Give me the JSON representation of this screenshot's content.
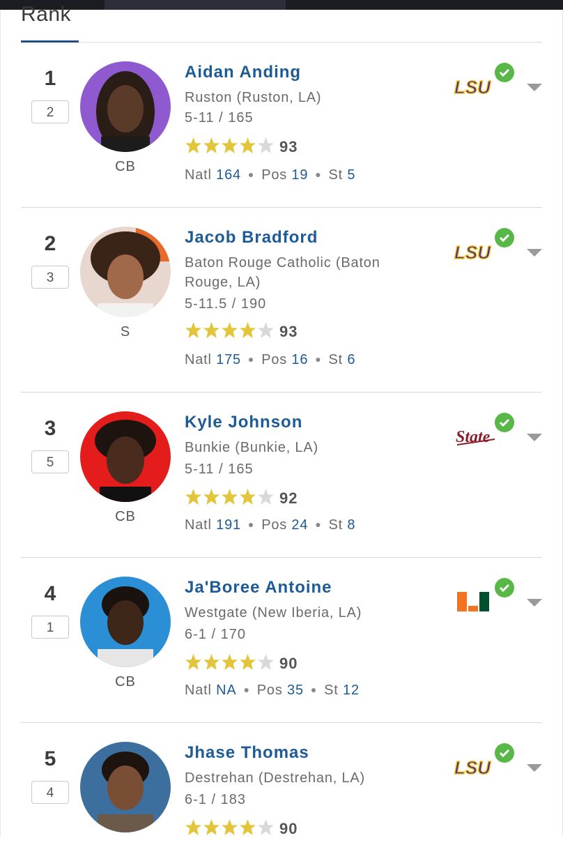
{
  "header": {
    "title": "Rank"
  },
  "colors": {
    "accent": "#1d5b96",
    "star": "#e2c53a",
    "star_empty": "#d9d9d9",
    "check": "#58b847"
  },
  "players": [
    {
      "rank": "1",
      "prev_rank": "2",
      "name": "Aidan Anding",
      "school": "Ruston (Ruston, LA)",
      "hw": "5-11 / 165",
      "position": "CB",
      "stars": 4,
      "rating": "93",
      "natl_label": "Natl",
      "natl": "164",
      "pos_label": "Pos",
      "pos_rank": "19",
      "st_label": "St",
      "st": "5",
      "commit": "LSU",
      "logo_icon": "lsu-logo-icon",
      "avatar_bg": "#8f5ad0"
    },
    {
      "rank": "2",
      "prev_rank": "3",
      "name": "Jacob Bradford",
      "school": "Baton Rouge Catholic (Baton Rouge, LA)",
      "hw": "5-11.5 / 190",
      "position": "S",
      "stars": 4,
      "rating": "93",
      "natl_label": "Natl",
      "natl": "175",
      "pos_label": "Pos",
      "pos_rank": "16",
      "st_label": "St",
      "st": "6",
      "commit": "LSU",
      "logo_icon": "lsu-logo-icon",
      "avatar_bg": "#e0e0e0"
    },
    {
      "rank": "3",
      "prev_rank": "5",
      "name": "Kyle Johnson",
      "school": "Bunkie (Bunkie, LA)",
      "hw": "5-11 / 165",
      "position": "CB",
      "stars": 4,
      "rating": "92",
      "natl_label": "Natl",
      "natl": "191",
      "pos_label": "Pos",
      "pos_rank": "24",
      "st_label": "St",
      "st": "8",
      "commit": "State",
      "logo_icon": "mississippi-state-logo-icon",
      "avatar_bg": "#e51c1c"
    },
    {
      "rank": "4",
      "prev_rank": "1",
      "name": "Ja'Boree Antoine",
      "school": "Westgate (New Iberia, LA)",
      "hw": "6-1 / 170",
      "position": "CB",
      "stars": 4,
      "rating": "90",
      "natl_label": "Natl",
      "natl": "NA",
      "pos_label": "Pos",
      "pos_rank": "35",
      "st_label": "St",
      "st": "12",
      "commit": "U",
      "logo_icon": "miami-logo-icon",
      "avatar_bg": "#2b8fd6"
    },
    {
      "rank": "5",
      "prev_rank": "4",
      "name": "Jhase Thomas",
      "school": "Destrehan (Destrehan, LA)",
      "hw": "6-1 / 183",
      "position": "",
      "stars": 4,
      "rating": "90",
      "commit": "LSU",
      "logo_icon": "lsu-logo-icon",
      "avatar_bg": "#3d6f9e"
    }
  ]
}
